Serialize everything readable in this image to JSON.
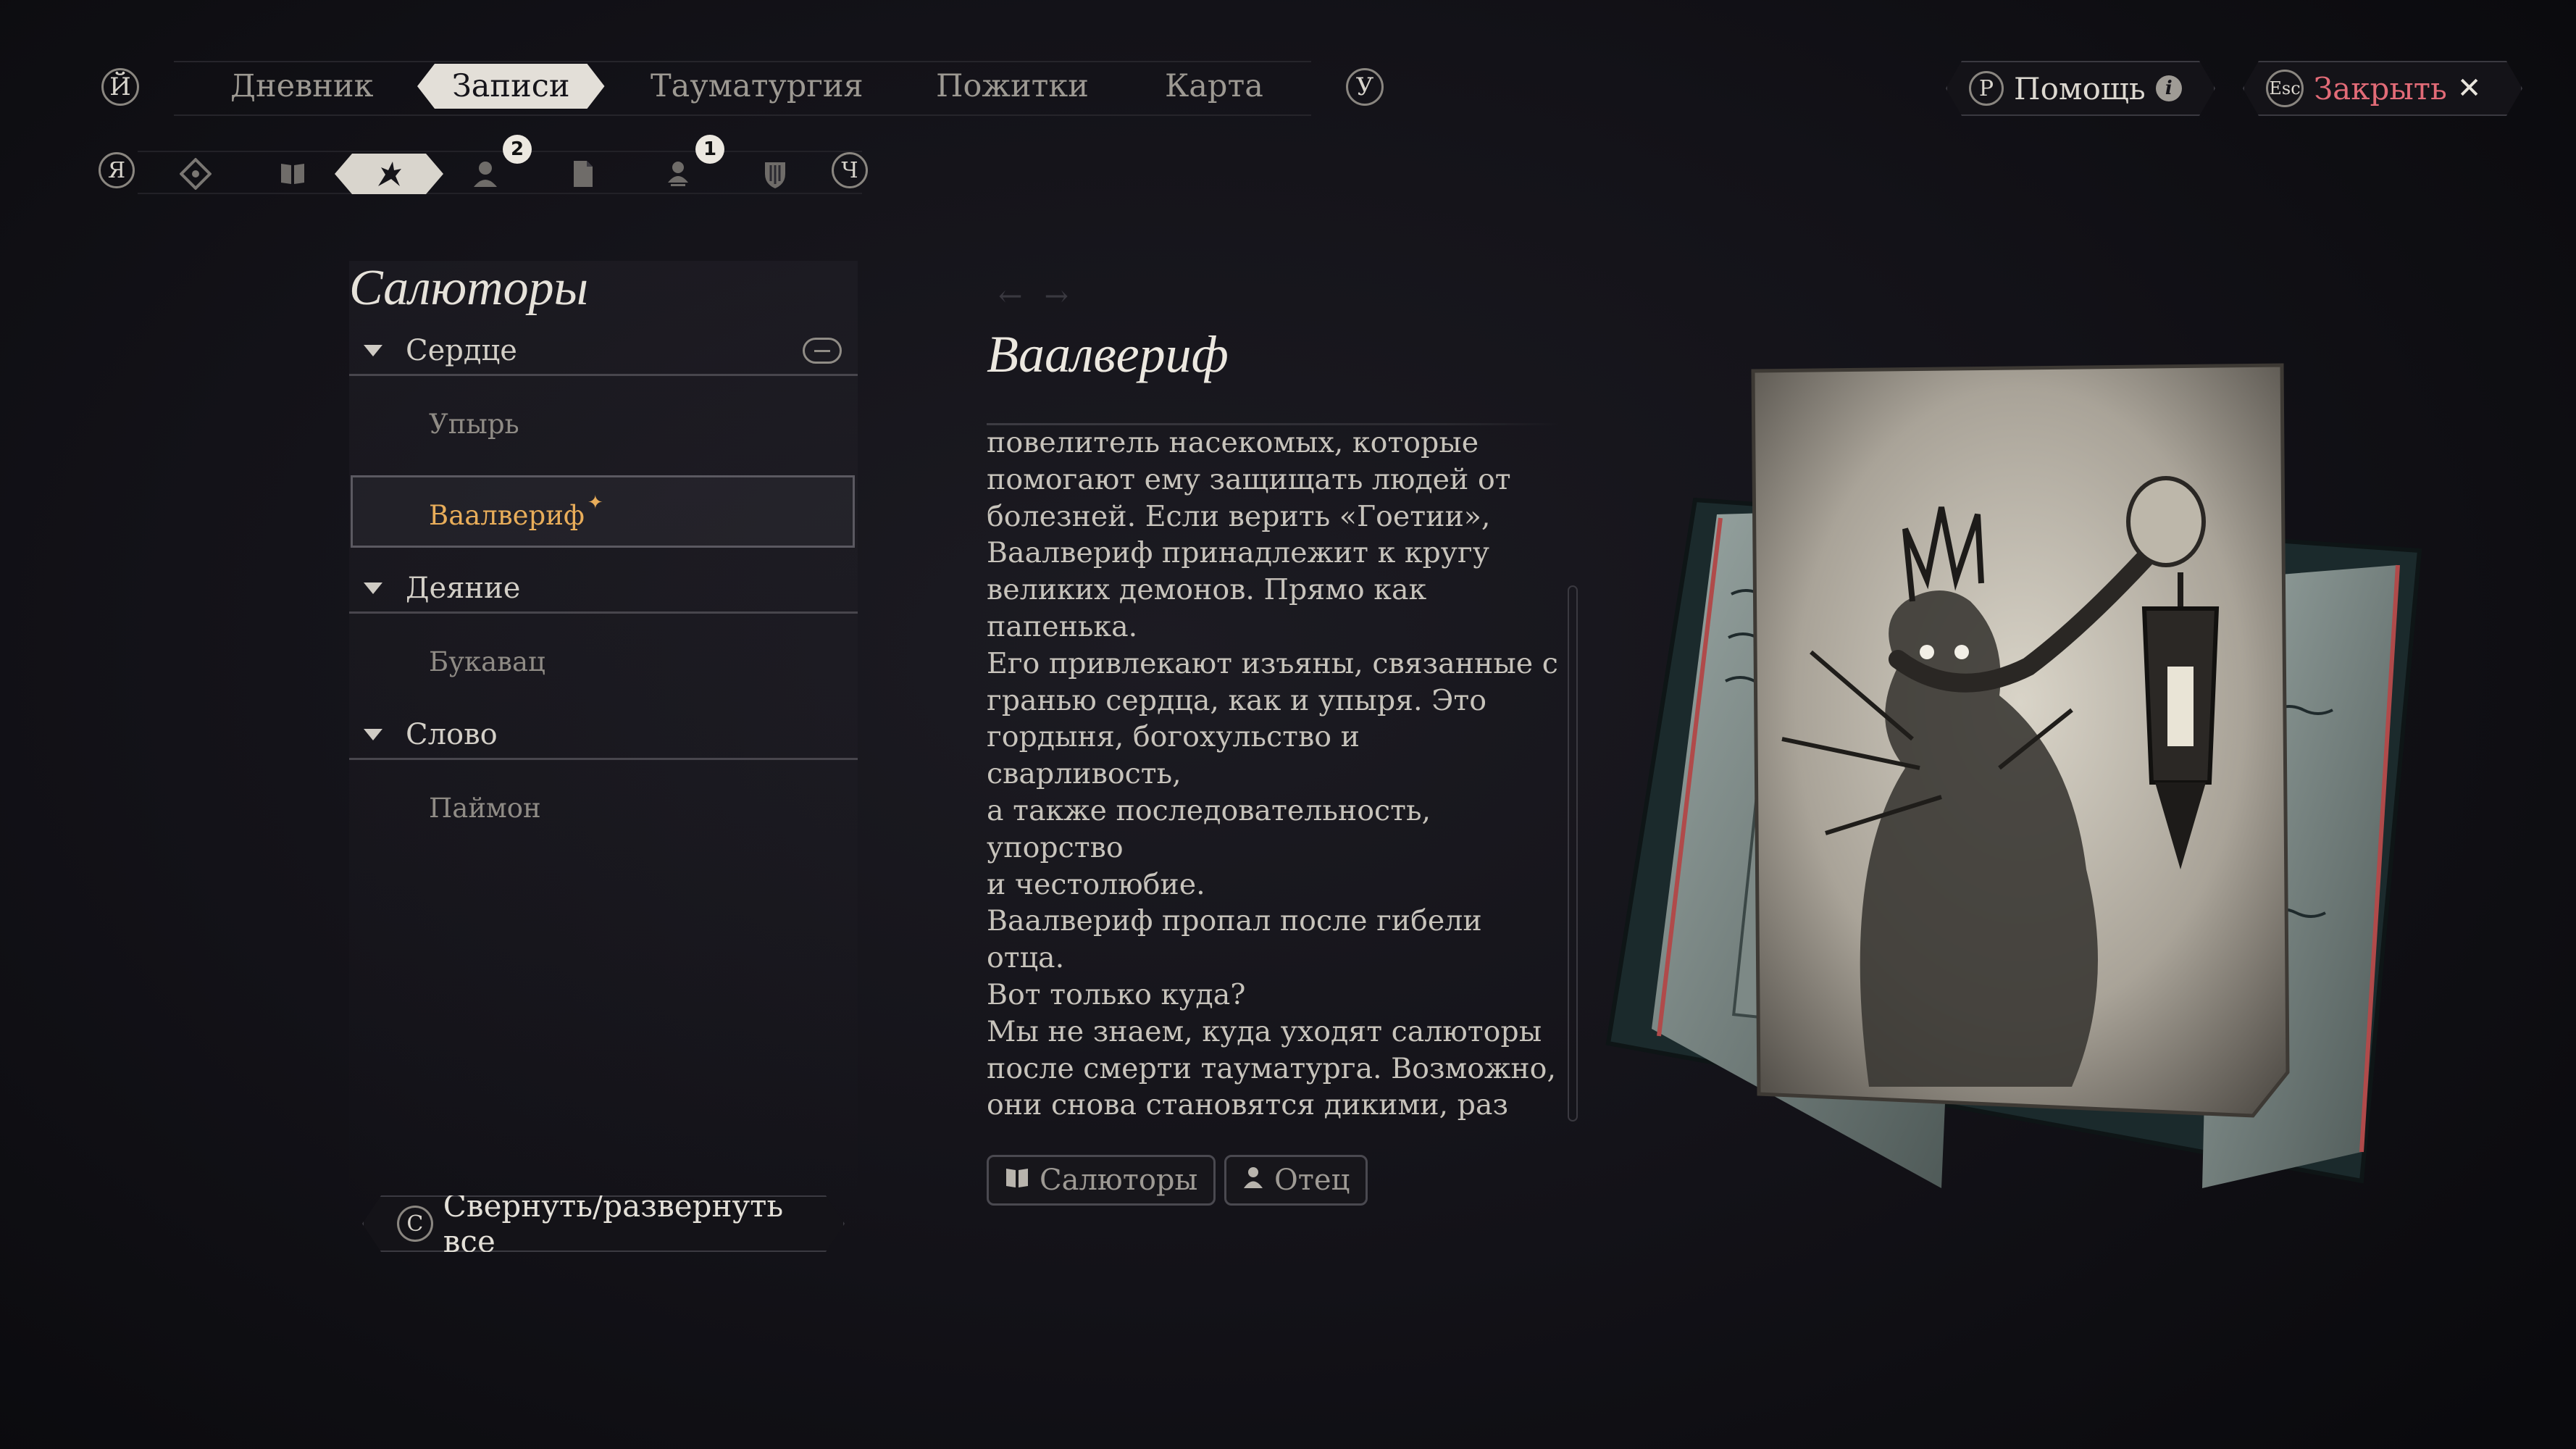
{
  "header": {
    "prev_key": "Й",
    "next_key": "У",
    "tabs": [
      {
        "label": "Дневник",
        "active": false
      },
      {
        "label": "Записи",
        "active": true
      },
      {
        "label": "Тауматургия",
        "active": false
      },
      {
        "label": "Пожитки",
        "active": false
      },
      {
        "label": "Карта",
        "active": false
      }
    ],
    "help": {
      "key": "P",
      "label": "Помощь"
    },
    "close": {
      "key": "Esc",
      "label": "Закрыть"
    }
  },
  "categories": {
    "prev_key": "Я",
    "next_key": "Ч",
    "icons": [
      {
        "name": "map-marker-icon"
      },
      {
        "name": "book-icon"
      },
      {
        "name": "salutor-icon",
        "active": true
      },
      {
        "name": "person-icon",
        "badge": "2"
      },
      {
        "name": "document-icon"
      },
      {
        "name": "location-person-icon",
        "badge": "1"
      },
      {
        "name": "shield-icon"
      }
    ]
  },
  "list": {
    "title": "Салюторы",
    "groups": [
      {
        "label": "Сердце",
        "entries": [
          "Упырь",
          "Ваалвериф"
        ]
      },
      {
        "label": "Деяние",
        "entries": [
          "Букавац"
        ]
      },
      {
        "label": "Слово",
        "entries": [
          "Паймон"
        ]
      }
    ],
    "selected": "Ваалвериф",
    "new_mark": "✦",
    "collapse_all": {
      "key": "C",
      "label": "Свернуть/развернуть все"
    }
  },
  "detail": {
    "title": "Ваалвериф",
    "body": "повелитель насекомых, которые\nпомогают ему защищать людей от\nболезней. Если верить «Гоетии»,\nВаалвериф принадлежит к кругу\nвеликих демонов. Прямо как папенька.\nЕго привлекают изъяны, связанные с\nгранью сердца, как и упыря. Это\nгордыня, богохульство и сварливость,\nа также последовательность, упорство\nи честолюбие.\nВаалвериф пропал после гибели отца.\nВот только куда?\nМы не знаем, куда уходят салюторы\nпосле смерти тауматурга. Возможно,\nони снова становятся дикими, раз уж\nсвязь с хозяином разорвана. Но вместе\nс ней теряется и изъян — так что\nвполне возможно, что салюторы\nпросто исчезают.",
    "tags": [
      {
        "icon": "book-icon",
        "label": "Салюторы"
      },
      {
        "icon": "person-icon",
        "label": "Отец"
      }
    ]
  },
  "colors": {
    "accent_selected": "#e8ad5a",
    "close_red": "#e26b77",
    "active_tab_bg": "#e3dfd8",
    "background": "#131218"
  }
}
